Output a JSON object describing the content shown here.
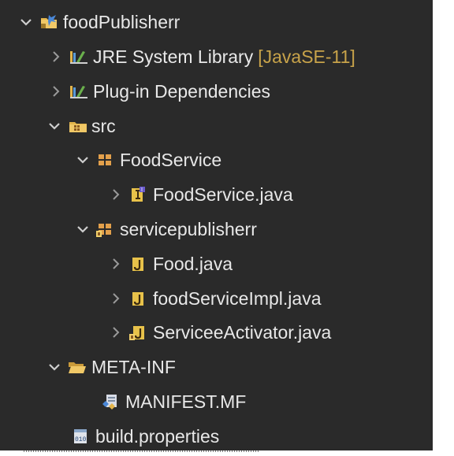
{
  "tree": {
    "project": {
      "label": "foodPublisherr"
    },
    "jre": {
      "label": "JRE System Library",
      "decoration": "[JavaSE-11]"
    },
    "plugin_deps": {
      "label": "Plug-in Dependencies"
    },
    "src": {
      "label": "src"
    },
    "pkg_foodservice": {
      "label": "FoodService"
    },
    "file_foodservice": {
      "label": "FoodService.java"
    },
    "pkg_servicepublisher": {
      "label": "servicepublisherr"
    },
    "file_food": {
      "label": "Food.java"
    },
    "file_foodserviceimpl": {
      "label": "foodServiceImpl.java"
    },
    "file_activator": {
      "label": "ServiceeActivator.java"
    },
    "meta_inf": {
      "label": "META-INF"
    },
    "manifest": {
      "label": "MANIFEST.MF"
    },
    "build_props": {
      "label": "build.properties"
    }
  },
  "colors": {
    "background": "#2a2a2a",
    "text": "#e8e8e8",
    "decoration": "#c8a34a",
    "twisty": "#cfcfcf"
  }
}
